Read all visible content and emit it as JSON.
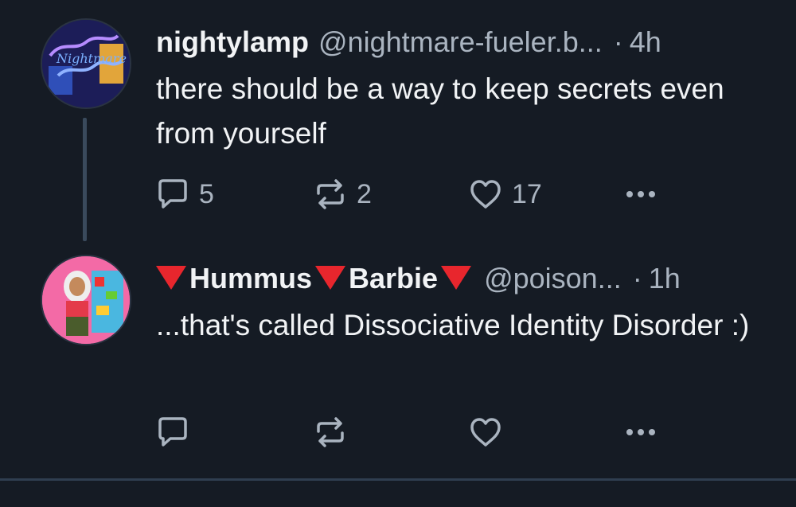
{
  "posts": [
    {
      "display_name": "nightylamp",
      "handle": "@nightmare-fueler.b...",
      "separator": "·",
      "time": "4h",
      "text": "there should be a way to keep secrets even from yourself",
      "reply_count": "5",
      "repost_count": "2",
      "like_count": "17",
      "avatar_text": "Nightmare fueler"
    },
    {
      "display_name_parts": [
        "Hummus",
        "Barbie"
      ],
      "handle": "@poison...",
      "separator": "·",
      "time": "1h",
      "text": "...that's called Dissociative Identity Disorder :)",
      "reply_count": "",
      "repost_count": "",
      "like_count": ""
    }
  ],
  "colors": {
    "background": "#151b24",
    "muted": "#aab4c0",
    "triangle": "#e8262d"
  },
  "icons": [
    "reply-icon",
    "repost-icon",
    "like-icon",
    "more-icon"
  ]
}
